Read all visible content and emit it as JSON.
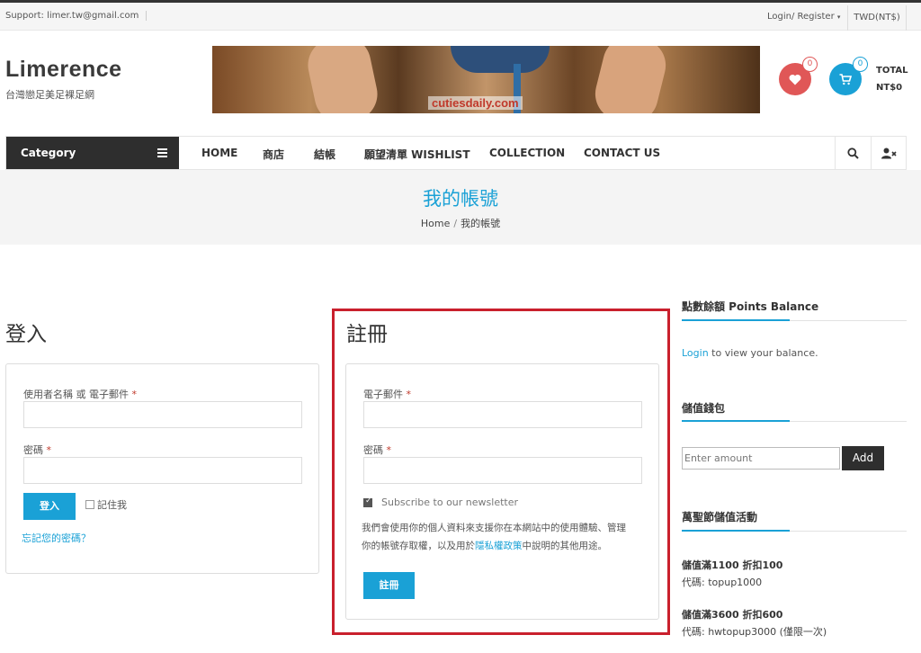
{
  "topbar": {
    "support": "Support: limer.tw@gmail.com",
    "login_register": "Login/ Register",
    "currency": "TWD(NT$)"
  },
  "header": {
    "logo": "Limerence",
    "tagline": "台灣戀足美足裸足網",
    "banner_watermark": "cutiesdaily.com",
    "wishlist_count": "0",
    "cart_count": "0",
    "total_label": "TOTAL",
    "total_value": "NT$0"
  },
  "nav": {
    "category": "Category",
    "items": [
      "HOME",
      "商店",
      "結帳",
      "願望清單 WISHLIST",
      "COLLECTION",
      "CONTACT US"
    ]
  },
  "page": {
    "title": "我的帳號",
    "breadcrumb": [
      "Home",
      "我的帳號"
    ],
    "breadcrumb_sep": "/"
  },
  "login": {
    "heading": "登入",
    "username_label": "使用者名稱 或 電子郵件",
    "password_label": "密碼",
    "required_mark": "*",
    "submit": "登入",
    "remember": "記住我",
    "forgot": "忘記您的密碼？"
  },
  "register": {
    "heading": "註冊",
    "email_label": "電子郵件",
    "password_label": "密碼",
    "required_mark": "*",
    "newsletter": "Subscribe to our newsletter",
    "newsletter_checked": true,
    "privacy_line1": "我們會使用你的個人資料來支援你在本網站中的使用體驗、管理",
    "privacy_line2_pre": "你的帳號存取權，以及用於",
    "privacy_link": "隱私權政策",
    "privacy_line2_post": "中說明的其他用途。",
    "submit": "註冊"
  },
  "sidebar": {
    "points_heading": "點數餘額 Points Balance",
    "login_link": "Login",
    "login_rest": " to view your balance.",
    "wallet_heading": "儲值錢包",
    "amount_placeholder": "Enter amount",
    "add_label": "Add",
    "promo_heading": "萬聖節儲值活動",
    "promos": [
      {
        "title": "儲值滿1100 折扣100",
        "code": "代碼: topup1000"
      },
      {
        "title": "儲值滿3600 折扣600",
        "code": "代碼: hwtopup3000 (僅限一次)"
      }
    ]
  },
  "colors": {
    "accent": "#1aa1d6",
    "wishlist": "#e05757",
    "dark": "#2e2e2e",
    "highlight_border": "#c9202d"
  }
}
